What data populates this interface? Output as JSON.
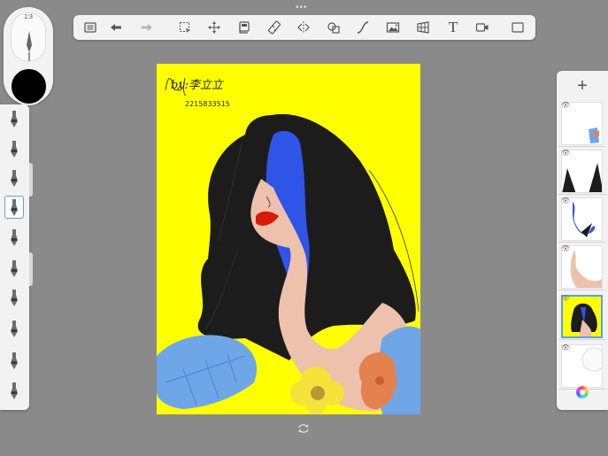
{
  "top_handle": "•••",
  "toolbar": {
    "tools": [
      {
        "name": "gallery-icon"
      },
      {
        "name": "undo-icon"
      },
      {
        "name": "redo-icon"
      },
      {
        "name": "selection-icon"
      },
      {
        "name": "transform-icon"
      },
      {
        "name": "layers-copy-icon"
      },
      {
        "name": "ruler-icon"
      },
      {
        "name": "symmetry-icon"
      },
      {
        "name": "shapes-icon"
      },
      {
        "name": "curve-icon"
      },
      {
        "name": "image-icon"
      },
      {
        "name": "perspective-icon"
      },
      {
        "name": "text-tool-icon",
        "label": "T"
      },
      {
        "name": "video-icon"
      },
      {
        "name": "fullscreen-icon"
      }
    ]
  },
  "brush_panel": {
    "size_label": "1:3",
    "current_color": "#000000"
  },
  "brushes": [
    {
      "name": "brush-1"
    },
    {
      "name": "brush-2"
    },
    {
      "name": "brush-3"
    },
    {
      "name": "brush-4",
      "selected": true
    },
    {
      "name": "brush-5"
    },
    {
      "name": "brush-6"
    },
    {
      "name": "brush-7"
    },
    {
      "name": "brush-8"
    },
    {
      "name": "brush-9"
    },
    {
      "name": "brush-10"
    }
  ],
  "artwork": {
    "signature_line1": "by:李立立",
    "signature_line2": "2215833515",
    "colors": {
      "background": "#ffff00",
      "hair": "#1c1c1c",
      "blue": "#2f54e8",
      "skin": "#edc1ab",
      "lips": "#d61b0b",
      "leaf": "#6fa6e8",
      "flower": "#f5e23a",
      "orange": "#e3824e"
    }
  },
  "layers_panel": {
    "add_label": "+",
    "layers": [
      {
        "name": "layer-1"
      },
      {
        "name": "layer-2"
      },
      {
        "name": "layer-3"
      },
      {
        "name": "layer-4"
      },
      {
        "name": "layer-5",
        "active": true
      },
      {
        "name": "layer-6"
      }
    ]
  },
  "accent_color": "#5aa0e6"
}
